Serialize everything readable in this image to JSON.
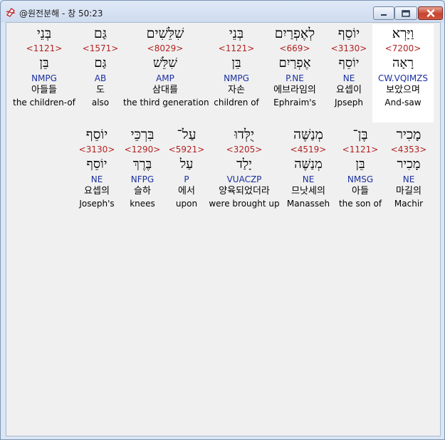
{
  "window": {
    "title": "@원전분해 - 창 50:23"
  },
  "icons": {
    "app": "app-logo-icon",
    "minimize": "minimize-icon",
    "maximize": "maximize-icon",
    "close": "close-icon"
  },
  "rows": [
    [
      {
        "heb": "וַיַּרְא",
        "strong": "<7200>",
        "lemma": "רָאָה",
        "morph": "CW.VQIMZS",
        "kor": "보았으며",
        "eng": "And-saw",
        "selected": true
      },
      {
        "heb": "יוֹסֵף",
        "strong": "<3130>",
        "lemma": "יוֹסֵף",
        "morph": "NE",
        "kor": "요셉이",
        "eng": "Jpseph",
        "selected": false
      },
      {
        "heb": "לְאֶפְרַיִם",
        "strong": "<669>",
        "lemma": "אֶפְרַיִם",
        "morph": "P.NE",
        "kor": "에브라임의",
        "eng": "Ephraim's",
        "selected": false
      },
      {
        "heb": "בְּנֵי",
        "strong": "<1121>",
        "lemma": "בֵּן",
        "morph": "NMPG",
        "kor": "자손",
        "eng": "children of",
        "selected": false
      },
      {
        "heb": "שִׁלֵּשִׁים",
        "strong": "<8029>",
        "lemma": "שִׁלֵּשׁ",
        "morph": "AMP",
        "kor": "삼대를",
        "eng": "the third generation",
        "selected": false
      },
      {
        "heb": "גַּם",
        "strong": "<1571>",
        "lemma": "גַּם",
        "morph": "AB",
        "kor": "도",
        "eng": "also",
        "selected": false
      },
      {
        "heb": "בְּנֵי",
        "strong": "<1121>",
        "lemma": "בֵּן",
        "morph": "NMPG",
        "kor": "아들들",
        "eng": "the children-of",
        "selected": false
      }
    ],
    [
      {
        "heb": "מָכִיר",
        "strong": "<4353>",
        "lemma": "מָכִיר",
        "morph": "NE",
        "kor": "마길의",
        "eng": "Machir",
        "selected": false
      },
      {
        "heb": "בֶּן־",
        "strong": "<1121>",
        "lemma": "בֵּן",
        "morph": "NMSG",
        "kor": "아들",
        "eng": "the son of",
        "selected": false
      },
      {
        "heb": "מְנַשֶּׁה",
        "strong": "<4519>",
        "lemma": "מְנַשֶּׁה",
        "morph": "NE",
        "kor": "므낫세의",
        "eng": "Manasseh",
        "selected": false
      },
      {
        "heb": "יֻלְּדוּ",
        "strong": "<3205>",
        "lemma": "יָלַד",
        "morph": "VUACZP",
        "kor": "양육되었더라",
        "eng": "were brought up",
        "selected": false
      },
      {
        "heb": "עַל־",
        "strong": "<5921>",
        "lemma": "עַל",
        "morph": "P",
        "kor": "에서",
        "eng": "upon",
        "selected": false
      },
      {
        "heb": "בִּרְכֵּי",
        "strong": "<1290>",
        "lemma": "בֶּרֶךְ",
        "morph": "NFPG",
        "kor": "슬하",
        "eng": "knees",
        "selected": false
      },
      {
        "heb": "יוֹסֵף",
        "strong": "<3130>",
        "lemma": "יוֹסֵף",
        "morph": "NE",
        "kor": "요셉의",
        "eng": "Joseph's",
        "selected": false
      }
    ]
  ]
}
